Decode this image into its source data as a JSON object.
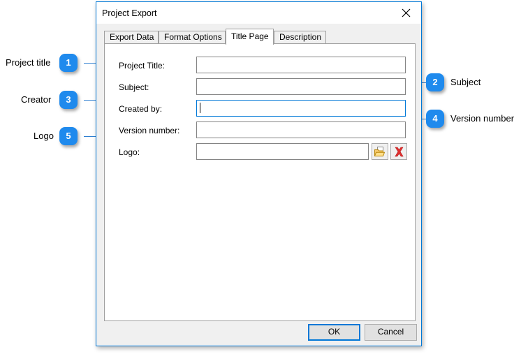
{
  "window": {
    "title": "Project Export",
    "close_icon": "close-icon"
  },
  "tabs": [
    {
      "label": "Export Data",
      "selected": false
    },
    {
      "label": "Format Options",
      "selected": false
    },
    {
      "label": "Title Page",
      "selected": true
    },
    {
      "label": "Description",
      "selected": false
    }
  ],
  "form": {
    "fields": [
      {
        "label": "Project Title:",
        "value": "",
        "focused": false
      },
      {
        "label": "Subject:",
        "value": "",
        "focused": false
      },
      {
        "label": "Created by:",
        "value": "",
        "focused": true
      },
      {
        "label": "Version number:",
        "value": "",
        "focused": false
      },
      {
        "label": "Logo:",
        "value": "",
        "focused": false
      }
    ],
    "logo_browse_icon": "open-folder-icon",
    "logo_clear_icon": "red-x-delete-icon"
  },
  "footer": {
    "ok_label": "OK",
    "cancel_label": "Cancel"
  },
  "annotations": [
    {
      "number": "1",
      "label": "Project title",
      "side": "left"
    },
    {
      "number": "2",
      "label": "Subject",
      "side": "right"
    },
    {
      "number": "3",
      "label": "Creator",
      "side": "left"
    },
    {
      "number": "4",
      "label": "Version number",
      "side": "right"
    },
    {
      "number": "5",
      "label": "Logo",
      "side": "left"
    }
  ],
  "colors": {
    "accent": "#0078d7",
    "badge": "#1f8aed",
    "leader_line": "#2f7fd0",
    "dialog_face": "#f0f0f0",
    "panel": "#ffffff",
    "field_border": "#848484"
  }
}
